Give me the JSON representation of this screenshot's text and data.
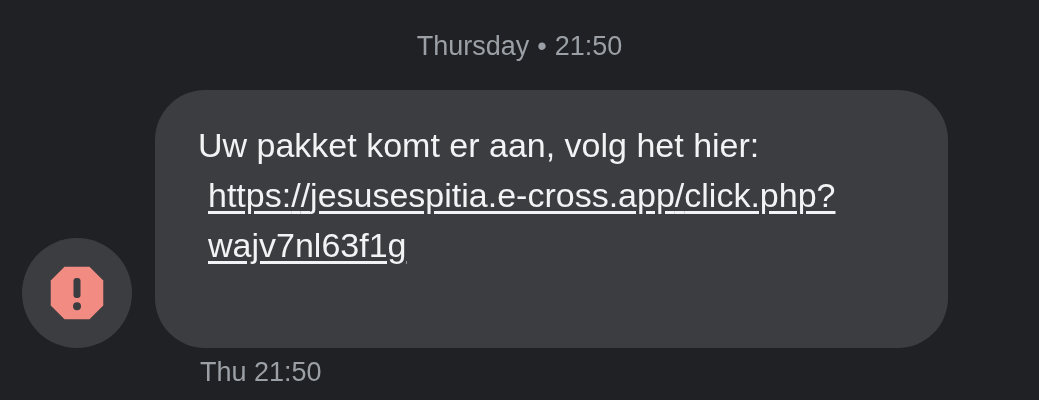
{
  "header": {
    "day": "Thursday",
    "separator": "•",
    "time": "21:50"
  },
  "message": {
    "text": "Uw pakket komt er aan, volg het hier:",
    "link": "https://jesusespitia.e-cross.app/click.php?wajv7nl63f1g",
    "error": true,
    "timestamp": "Thu 21:50"
  }
}
